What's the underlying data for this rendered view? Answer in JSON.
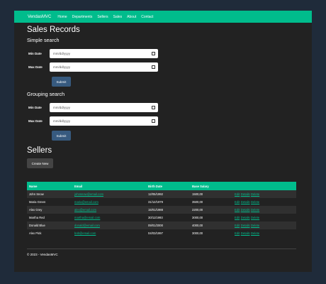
{
  "navbar": {
    "brand": "VendasMVC",
    "links": [
      "Home",
      "Departments",
      "Sellers",
      "Sales",
      "About",
      "Contact"
    ]
  },
  "sales": {
    "title": "Sales Records",
    "simple": {
      "heading": "Simple search",
      "min_label": "Min Date",
      "max_label": "Max Date",
      "min_value": "mm/dd/yyyy",
      "max_value": "mm/dd/yyyy",
      "submit": "Submit"
    },
    "grouping": {
      "heading": "Grouping search",
      "min_label": "Min Date",
      "max_label": "Max Date",
      "min_value": "mm/dd/yyyy",
      "max_value": "mm/dd/yyyy",
      "submit": "Submit"
    }
  },
  "sellers": {
    "title": "Sellers",
    "create_label": "Create New",
    "columns": [
      "Name",
      "Email",
      "Birth Date",
      "Base Salary",
      ""
    ],
    "actions": [
      "Edit",
      "Details",
      "Delete"
    ],
    "rows": [
      {
        "name": "John Snow",
        "email": "johnsnow@email.com",
        "birth": "12/05/1992",
        "salary": "1500,00"
      },
      {
        "name": "Maria Green",
        "email": "maria@email.com",
        "birth": "31/12/1979",
        "salary": "3500,00"
      },
      {
        "name": "Alex Grey",
        "email": "alex@email.com",
        "birth": "15/01/1988",
        "salary": "2200,00"
      },
      {
        "name": "Martha Red",
        "email": "martha@email.com",
        "birth": "30/11/1993",
        "salary": "3000,00"
      },
      {
        "name": "Donald Blue",
        "email": "donald@email.com",
        "birth": "09/01/2000",
        "salary": "4000,00"
      },
      {
        "name": "Alex Pink",
        "email": "bob@email.com",
        "birth": "04/03/1997",
        "salary": "3000,00"
      }
    ]
  },
  "footer": {
    "text": "© 2023 - VendasMVC"
  },
  "colors": {
    "accent": "#00bc8c",
    "primary_button": "#375a7f",
    "page_bg": "#222222",
    "outer_bg": "#1f2b3a"
  }
}
